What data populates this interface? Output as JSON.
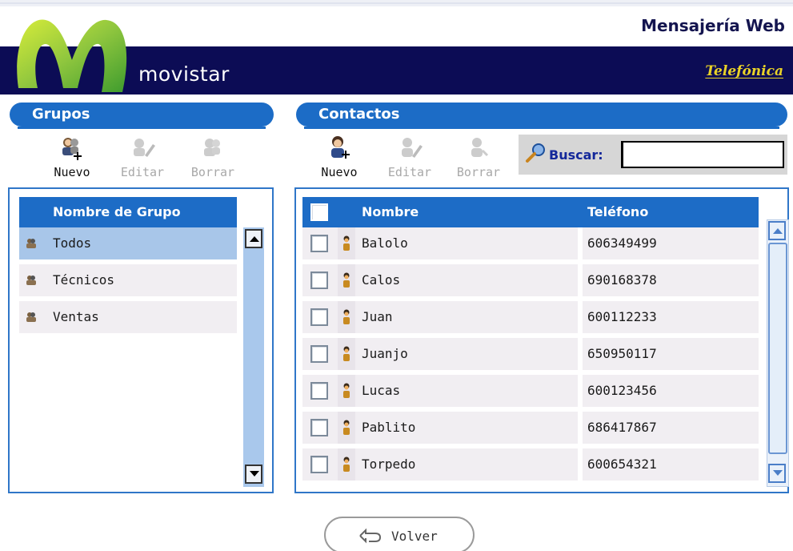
{
  "header": {
    "app_title": "Mensajería Web",
    "brand": "movistar",
    "partner": "Telefónica",
    "colors": {
      "navbar": "#0c0c55",
      "accent": "#1c6cc6",
      "partner_text": "#e9d227"
    }
  },
  "groups": {
    "title": "Grupos",
    "toolbar": [
      {
        "label": "Nuevo",
        "icon": "group-new-icon",
        "enabled": true
      },
      {
        "label": "Editar",
        "icon": "group-edit-icon",
        "enabled": false
      },
      {
        "label": "Borrar",
        "icon": "group-delete-icon",
        "enabled": false
      }
    ],
    "column_header": "Nombre de Grupo",
    "rows": [
      {
        "name": "Todos",
        "selected": true
      },
      {
        "name": "Técnicos",
        "selected": false
      },
      {
        "name": "Ventas",
        "selected": false
      }
    ]
  },
  "contacts": {
    "title": "Contactos",
    "toolbar": [
      {
        "label": "Nuevo",
        "icon": "contact-new-icon",
        "enabled": true
      },
      {
        "label": "Editar",
        "icon": "contact-edit-icon",
        "enabled": false
      },
      {
        "label": "Borrar",
        "icon": "contact-delete-icon",
        "enabled": false
      }
    ],
    "search": {
      "label": "Buscar:",
      "value": ""
    },
    "columns": {
      "name": "Nombre",
      "phone": "Teléfono"
    },
    "rows": [
      {
        "name": "Balolo",
        "phone": "606349499"
      },
      {
        "name": "Calos",
        "phone": "690168378"
      },
      {
        "name": "Juan",
        "phone": "600112233"
      },
      {
        "name": "Juanjo",
        "phone": "650950117"
      },
      {
        "name": "Lucas",
        "phone": "600123456"
      },
      {
        "name": "Pablito",
        "phone": "686417867"
      },
      {
        "name": "Torpedo",
        "phone": "600654321"
      }
    ]
  },
  "footer": {
    "back_label": "Volver"
  }
}
